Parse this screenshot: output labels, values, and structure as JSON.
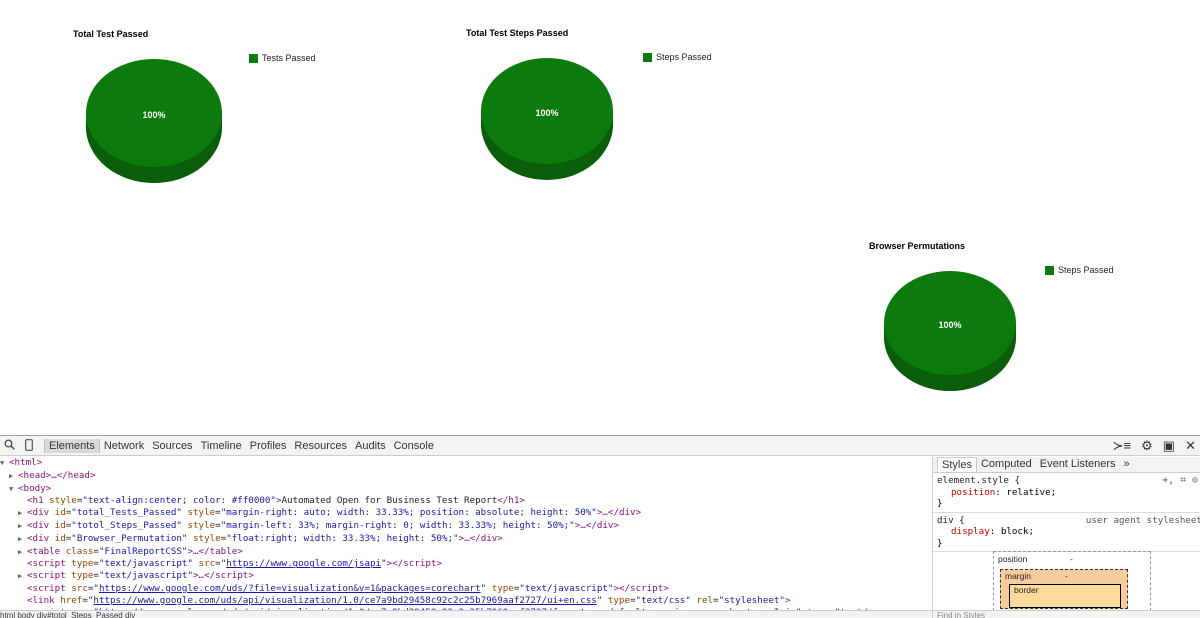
{
  "colors": {
    "pie_top": "#0d7a0d",
    "pie_side": "#0a5e0a",
    "pie_label": "#ffffff",
    "legend_swatch": "#0d7a0d"
  },
  "charts": [
    {
      "title": "Total Test Passed",
      "legend": "Tests Passed",
      "label": "100%"
    },
    {
      "title": "Total Test Steps Passed",
      "legend": "Steps Passed",
      "label": "100%"
    },
    {
      "title": "Browser Permutations",
      "legend": "Steps Passed",
      "label": "100%"
    }
  ],
  "chart_data": [
    {
      "type": "pie",
      "title": "Total Test Passed",
      "slices": [
        {
          "label": "Tests Passed",
          "value": 100
        }
      ],
      "legend_position": "right"
    },
    {
      "type": "pie",
      "title": "Total Test Steps Passed",
      "slices": [
        {
          "label": "Steps Passed",
          "value": 100
        }
      ],
      "legend_position": "right"
    },
    {
      "type": "pie",
      "title": "Browser Permutations",
      "slices": [
        {
          "label": "Steps Passed",
          "value": 100
        }
      ],
      "legend_position": "right"
    }
  ],
  "devtools": {
    "toolbar": {
      "search_icon": "search-icon",
      "device_icon": "device-icon",
      "tabs": [
        "Elements",
        "Network",
        "Sources",
        "Timeline",
        "Profiles",
        "Resources",
        "Audits",
        "Console"
      ],
      "active_tab": "Elements"
    },
    "dom": {
      "html_open": "<html>",
      "head": "<head>…</head>",
      "body_open": "<body>",
      "h1_tag_open": "<h1 ",
      "h1_attr": "style",
      "h1_val": "\"text-align:center; color: #ff0000\"",
      "h1_text": "Automated Open for Business Test Report",
      "h1_tag_close": "</h1>",
      "div1_id": "\"total_Tests_Passed\"",
      "div1_style": "\"margin-right: auto; width: 33.33%; position: absolute; height: 50%\"",
      "div2_id": "\"totol_Steps_Passed\"",
      "div2_style": "\"margin-left: 33%; margin-right: 0; width: 33.33%; height: 50%;\"",
      "div3_id": "\"Browser_Permutation\"",
      "div3_style": "\"float:right; width: 33.33%; height: 50%;\"",
      "table_class": "\"FinalReportCSS\"",
      "script1_type": "\"text/javascript\"",
      "script1_src": "https://www.google.com/jsapi",
      "script2_type": "\"text/javascript\"",
      "script3_src": "https://www.google.com/uds/?file=visualization&v=1&packages=corechart",
      "script3_type": "\"text/javascript\"",
      "link_href": "https://www.google.com/uds/api/visualization/1.0/ce7a9bd29458c92c2c25b7969aaf2727/ui+en.css",
      "link_type": "\"text/css\"",
      "link_rel": "\"stylesheet\"",
      "script4_src": "https://www.google.com/uds/api/visualization/1.0/ce7a9bd29458c92c2c25b7969aaf2727/format+en,default+en,ui+en,corechart+en.I.js",
      "script4_type": "\"text/"
    },
    "breadcrumb": "html   body   div#totol_Steps_Passed   div",
    "sidebar": {
      "tabs": [
        "Styles",
        "Computed",
        "Event Listeners",
        "»"
      ],
      "active_tab": "Styles",
      "element_style_selector": "element.style {",
      "element_style_prop": "position",
      "element_style_value": "relative;",
      "div_selector": "div {",
      "div_prop": "display",
      "div_value": "block;",
      "ua_label": "user agent stylesheet",
      "close_brace": "}",
      "box_position_label": "position",
      "box_position_value": "-",
      "box_margin_label": "margin",
      "box_margin_value": "-",
      "box_border_label": "border",
      "find_placeholder": "Find in Styles"
    }
  }
}
